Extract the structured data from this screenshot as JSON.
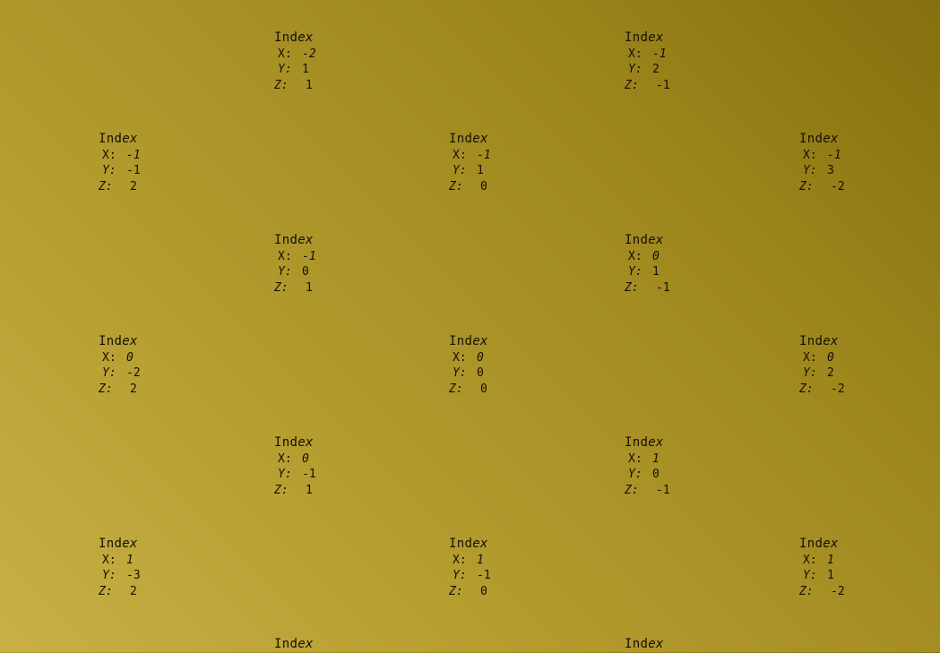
{
  "background": {
    "gradient_light": "#c9b045",
    "gradient_dark": "#85700f",
    "text_color": "#141000"
  },
  "labels": [
    {
      "title_a": "Ind",
      "title_b": "ex",
      "x_label": "X:",
      "x": "-2",
      "y_label": "Y:",
      "y": "1",
      "z_label": "Z:",
      "z": "1"
    },
    {
      "title_a": "Ind",
      "title_b": "ex",
      "x_label": "X:",
      "x": "-1",
      "y_label": "Y:",
      "y": "2",
      "z_label": "Z:",
      "z": "-1"
    },
    {
      "title_a": "Ind",
      "title_b": "ex",
      "x_label": "X:",
      "x": "-1",
      "y_label": "Y:",
      "y": "-1",
      "z_label": "Z:",
      "z": "2"
    },
    {
      "title_a": "Ind",
      "title_b": "ex",
      "x_label": "X:",
      "x": "-1",
      "y_label": "Y:",
      "y": "1",
      "z_label": "Z:",
      "z": "0"
    },
    {
      "title_a": "Ind",
      "title_b": "ex",
      "x_label": "X:",
      "x": "-1",
      "y_label": "Y:",
      "y": "3",
      "z_label": "Z:",
      "z": "-2"
    },
    {
      "title_a": "Ind",
      "title_b": "ex",
      "x_label": "X:",
      "x": "-1",
      "y_label": "Y:",
      "y": "0",
      "z_label": "Z:",
      "z": "1"
    },
    {
      "title_a": "Ind",
      "title_b": "ex",
      "x_label": "X:",
      "x": "0",
      "y_label": "Y:",
      "y": "1",
      "z_label": "Z:",
      "z": "-1"
    },
    {
      "title_a": "Ind",
      "title_b": "ex",
      "x_label": "X:",
      "x": "0",
      "y_label": "Y:",
      "y": "-2",
      "z_label": "Z:",
      "z": "2"
    },
    {
      "title_a": "Ind",
      "title_b": "ex",
      "x_label": "X:",
      "x": "0",
      "y_label": "Y:",
      "y": "0",
      "z_label": "Z:",
      "z": "0"
    },
    {
      "title_a": "Ind",
      "title_b": "ex",
      "x_label": "X:",
      "x": "0",
      "y_label": "Y:",
      "y": "2",
      "z_label": "Z:",
      "z": "-2"
    },
    {
      "title_a": "Ind",
      "title_b": "ex",
      "x_label": "X:",
      "x": "0",
      "y_label": "Y:",
      "y": "-1",
      "z_label": "Z:",
      "z": "1"
    },
    {
      "title_a": "Ind",
      "title_b": "ex",
      "x_label": "X:",
      "x": "1",
      "y_label": "Y:",
      "y": "0",
      "z_label": "Z:",
      "z": "-1"
    },
    {
      "title_a": "Ind",
      "title_b": "ex",
      "x_label": "X:",
      "x": "1",
      "y_label": "Y:",
      "y": "-3",
      "z_label": "Z:",
      "z": "2"
    },
    {
      "title_a": "Ind",
      "title_b": "ex",
      "x_label": "X:",
      "x": "1",
      "y_label": "Y:",
      "y": "-1",
      "z_label": "Z:",
      "z": "0"
    },
    {
      "title_a": "Ind",
      "title_b": "ex",
      "x_label": "X:",
      "x": "1",
      "y_label": "Y:",
      "y": "1",
      "z_label": "Z:",
      "z": "-2"
    },
    {
      "title_a": "Ind",
      "title_b": "ex"
    },
    {
      "title_a": "Ind",
      "title_b": "ex"
    }
  ]
}
